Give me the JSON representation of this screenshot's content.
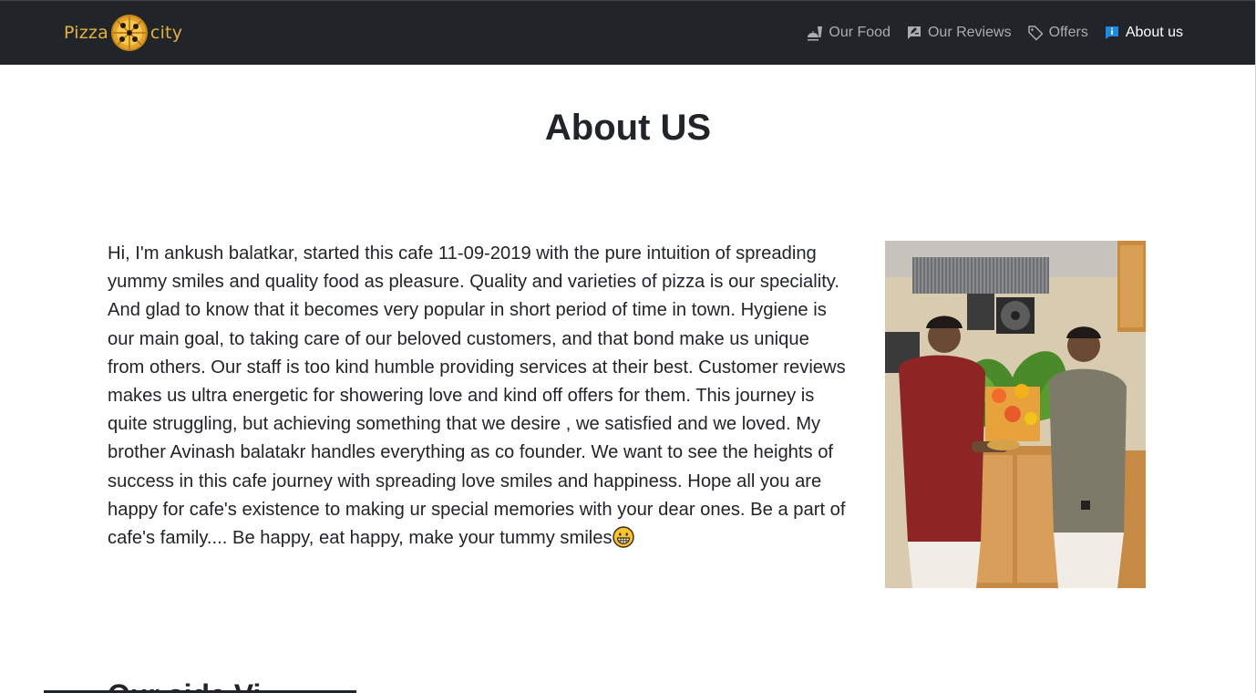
{
  "navbar": {
    "brand": {
      "left_text": "Pizza",
      "right_text": "city"
    },
    "items": [
      {
        "label": "Our Food",
        "icon": "food-icon",
        "active": false
      },
      {
        "label": "Our Reviews",
        "icon": "review-icon",
        "active": false
      },
      {
        "label": "Offers",
        "icon": "tag-icon",
        "active": false
      },
      {
        "label": "About us",
        "icon": "info-icon",
        "active": true
      }
    ]
  },
  "main": {
    "title": "About US",
    "body": "Hi, I'm ankush balatkar, started this cafe 11-09-2019 with the pure intuition of spreading yummy smiles and quality food as pleasure. Quality and varieties of pizza is our speciality. And glad to know that it becomes very popular in short period of time in town. Hygiene is our main goal, to taking care of our beloved customers, and that bond make us unique from others. Our staff is too kind humble providing services at their best. Customer reviews makes us ultra energetic for showering love and kind off offers for them. This journey is quite struggling, but achieving something that we desire , we satisfied and we loved. My brother Avinash balatakr handles everything as co founder. We want to see the heights of success in this cafe journey with spreading love smiles and happiness. Hope all you are happy for cafe's existence to making ur special memories with your dear ones. Be a part of cafe's family.... Be happy, eat happy, make your tummy smiles",
    "photo_icon": "founders-photo",
    "next_section_heading": "Our side Vi"
  },
  "colors": {
    "navbar_bg": "#212529",
    "brand_gold": "#e2b23a",
    "nav_inactive": "#a9acb0",
    "nav_active": "#ffffff",
    "info_blue": "#1e88e5"
  }
}
